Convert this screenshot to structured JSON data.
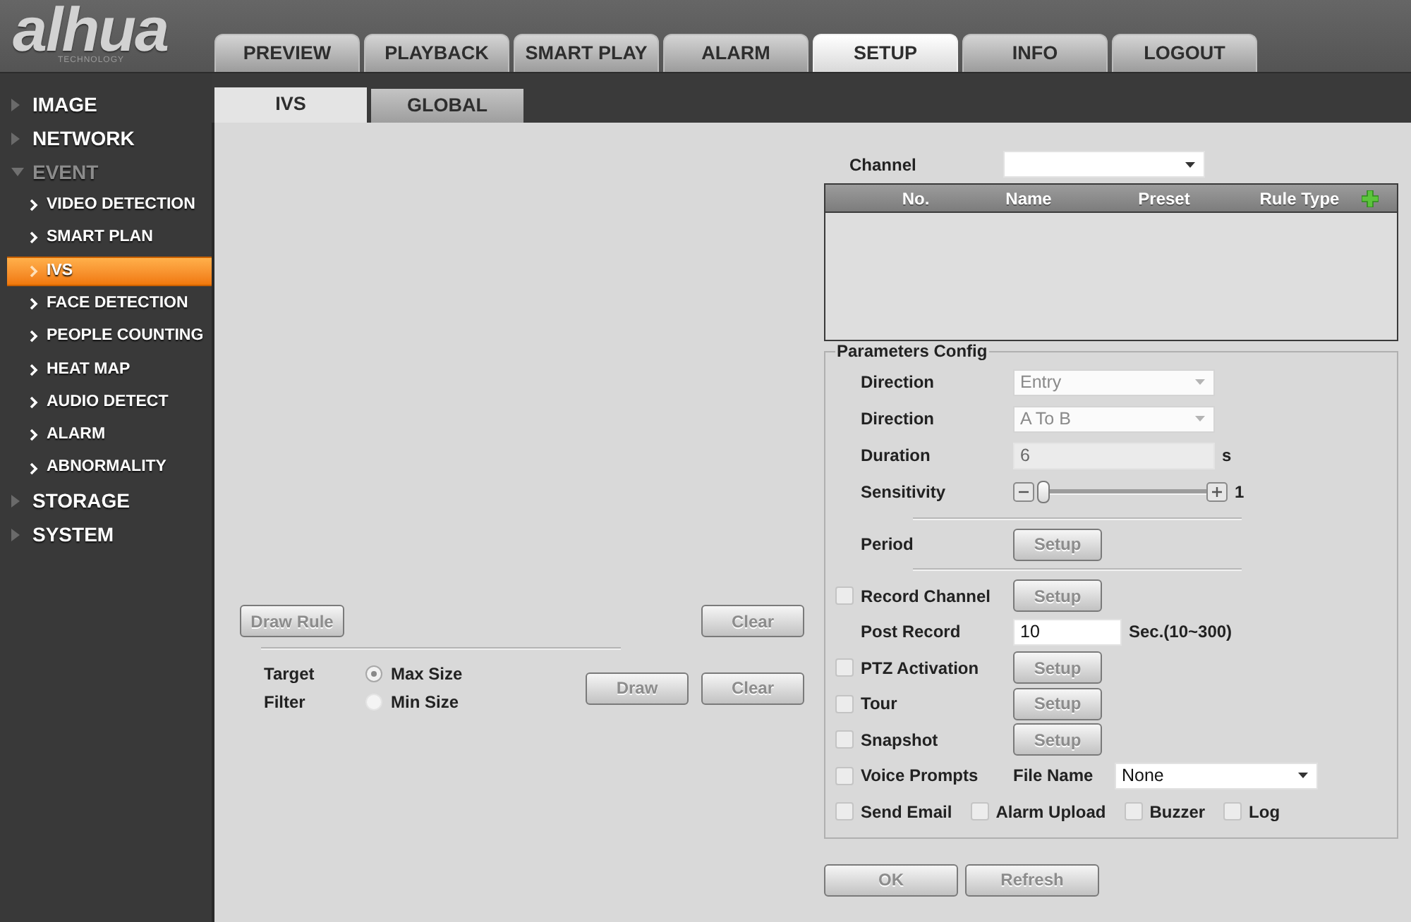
{
  "logo": {
    "wordmark": "alhua",
    "tagline": "TECHNOLOGY"
  },
  "nav_tabs": [
    {
      "label": "PREVIEW",
      "selected": false
    },
    {
      "label": "PLAYBACK",
      "selected": false
    },
    {
      "label": "SMART PLAY",
      "selected": false
    },
    {
      "label": "ALARM",
      "selected": false
    },
    {
      "label": "SETUP",
      "selected": true
    },
    {
      "label": "INFO",
      "selected": false
    },
    {
      "label": "LOGOUT",
      "selected": false
    }
  ],
  "sidebar": {
    "items": [
      {
        "label": "IMAGE",
        "expanded": false
      },
      {
        "label": "NETWORK",
        "expanded": false
      },
      {
        "label": "EVENT",
        "expanded": true,
        "children": [
          {
            "label": "VIDEO DETECTION",
            "selected": false
          },
          {
            "label": "SMART PLAN",
            "selected": false
          },
          {
            "label": "IVS",
            "selected": true
          },
          {
            "label": "FACE DETECTION",
            "selected": false
          },
          {
            "label": "PEOPLE COUNTING",
            "selected": false
          },
          {
            "label": "HEAT MAP",
            "selected": false
          },
          {
            "label": "AUDIO DETECT",
            "selected": false
          },
          {
            "label": "ALARM",
            "selected": false
          },
          {
            "label": "ABNORMALITY",
            "selected": false
          }
        ]
      },
      {
        "label": "STORAGE",
        "expanded": false
      },
      {
        "label": "SYSTEM",
        "expanded": false
      }
    ]
  },
  "sub_tabs": [
    {
      "label": "IVS",
      "selected": true
    },
    {
      "label": "GLOBAL",
      "selected": false
    }
  ],
  "rule_drawing": {
    "draw_rule_button": "Draw Rule",
    "clear_button": "Clear"
  },
  "target_filter": {
    "labels": [
      "Target",
      "Filter"
    ],
    "options": [
      {
        "label": "Max Size",
        "selected": true
      },
      {
        "label": "Min Size",
        "selected": false
      }
    ],
    "buttons": [
      "Draw",
      "Clear"
    ]
  },
  "channel": {
    "label": "Channel"
  },
  "rule_table": {
    "columns": [
      "No.",
      "Name",
      "Preset",
      "Rule Type"
    ]
  },
  "parameters": {
    "title": "Parameters Config",
    "rows": [
      {
        "kind": "select",
        "label": "Direction",
        "value": "Entry",
        "disabled": true
      },
      {
        "kind": "select",
        "label": "Direction",
        "value": "A To B",
        "disabled": true
      },
      {
        "kind": "text_field",
        "label": "Duration",
        "value": "6",
        "unit": "s",
        "disabled": true
      },
      {
        "kind": "slider",
        "label": "Sensitivity",
        "level": 0,
        "reading": "1"
      },
      {
        "kind": "button",
        "label": "Period",
        "button": "Setup"
      },
      {
        "kind": "checkbox_button",
        "label": "Record Channel",
        "checked": false,
        "button": "Setup"
      },
      {
        "kind": "number_field",
        "label": "Post Record",
        "value": "10",
        "unit": "Sec.(10~300)",
        "disabled": false
      },
      {
        "kind": "checkbox_button",
        "label": "PTZ Activation",
        "checked": false,
        "button": "Setup"
      },
      {
        "kind": "checkbox_button",
        "label": "Tour",
        "checked": false,
        "button": "Setup"
      },
      {
        "kind": "checkbox_button",
        "label": "Snapshot",
        "checked": false,
        "button": "Setup"
      },
      {
        "kind": "checkbox_select",
        "label": "Voice Prompts",
        "checked": false,
        "field_label": "File Name",
        "value": "None"
      },
      {
        "kind": "checkbox_group",
        "items": [
          {
            "label": "Send Email",
            "checked": false
          },
          {
            "label": "Alarm Upload",
            "checked": false
          },
          {
            "label": "Buzzer",
            "checked": false
          },
          {
            "label": "Log",
            "checked": false
          }
        ]
      }
    ]
  },
  "buttons": [
    "OK",
    "Refresh"
  ]
}
